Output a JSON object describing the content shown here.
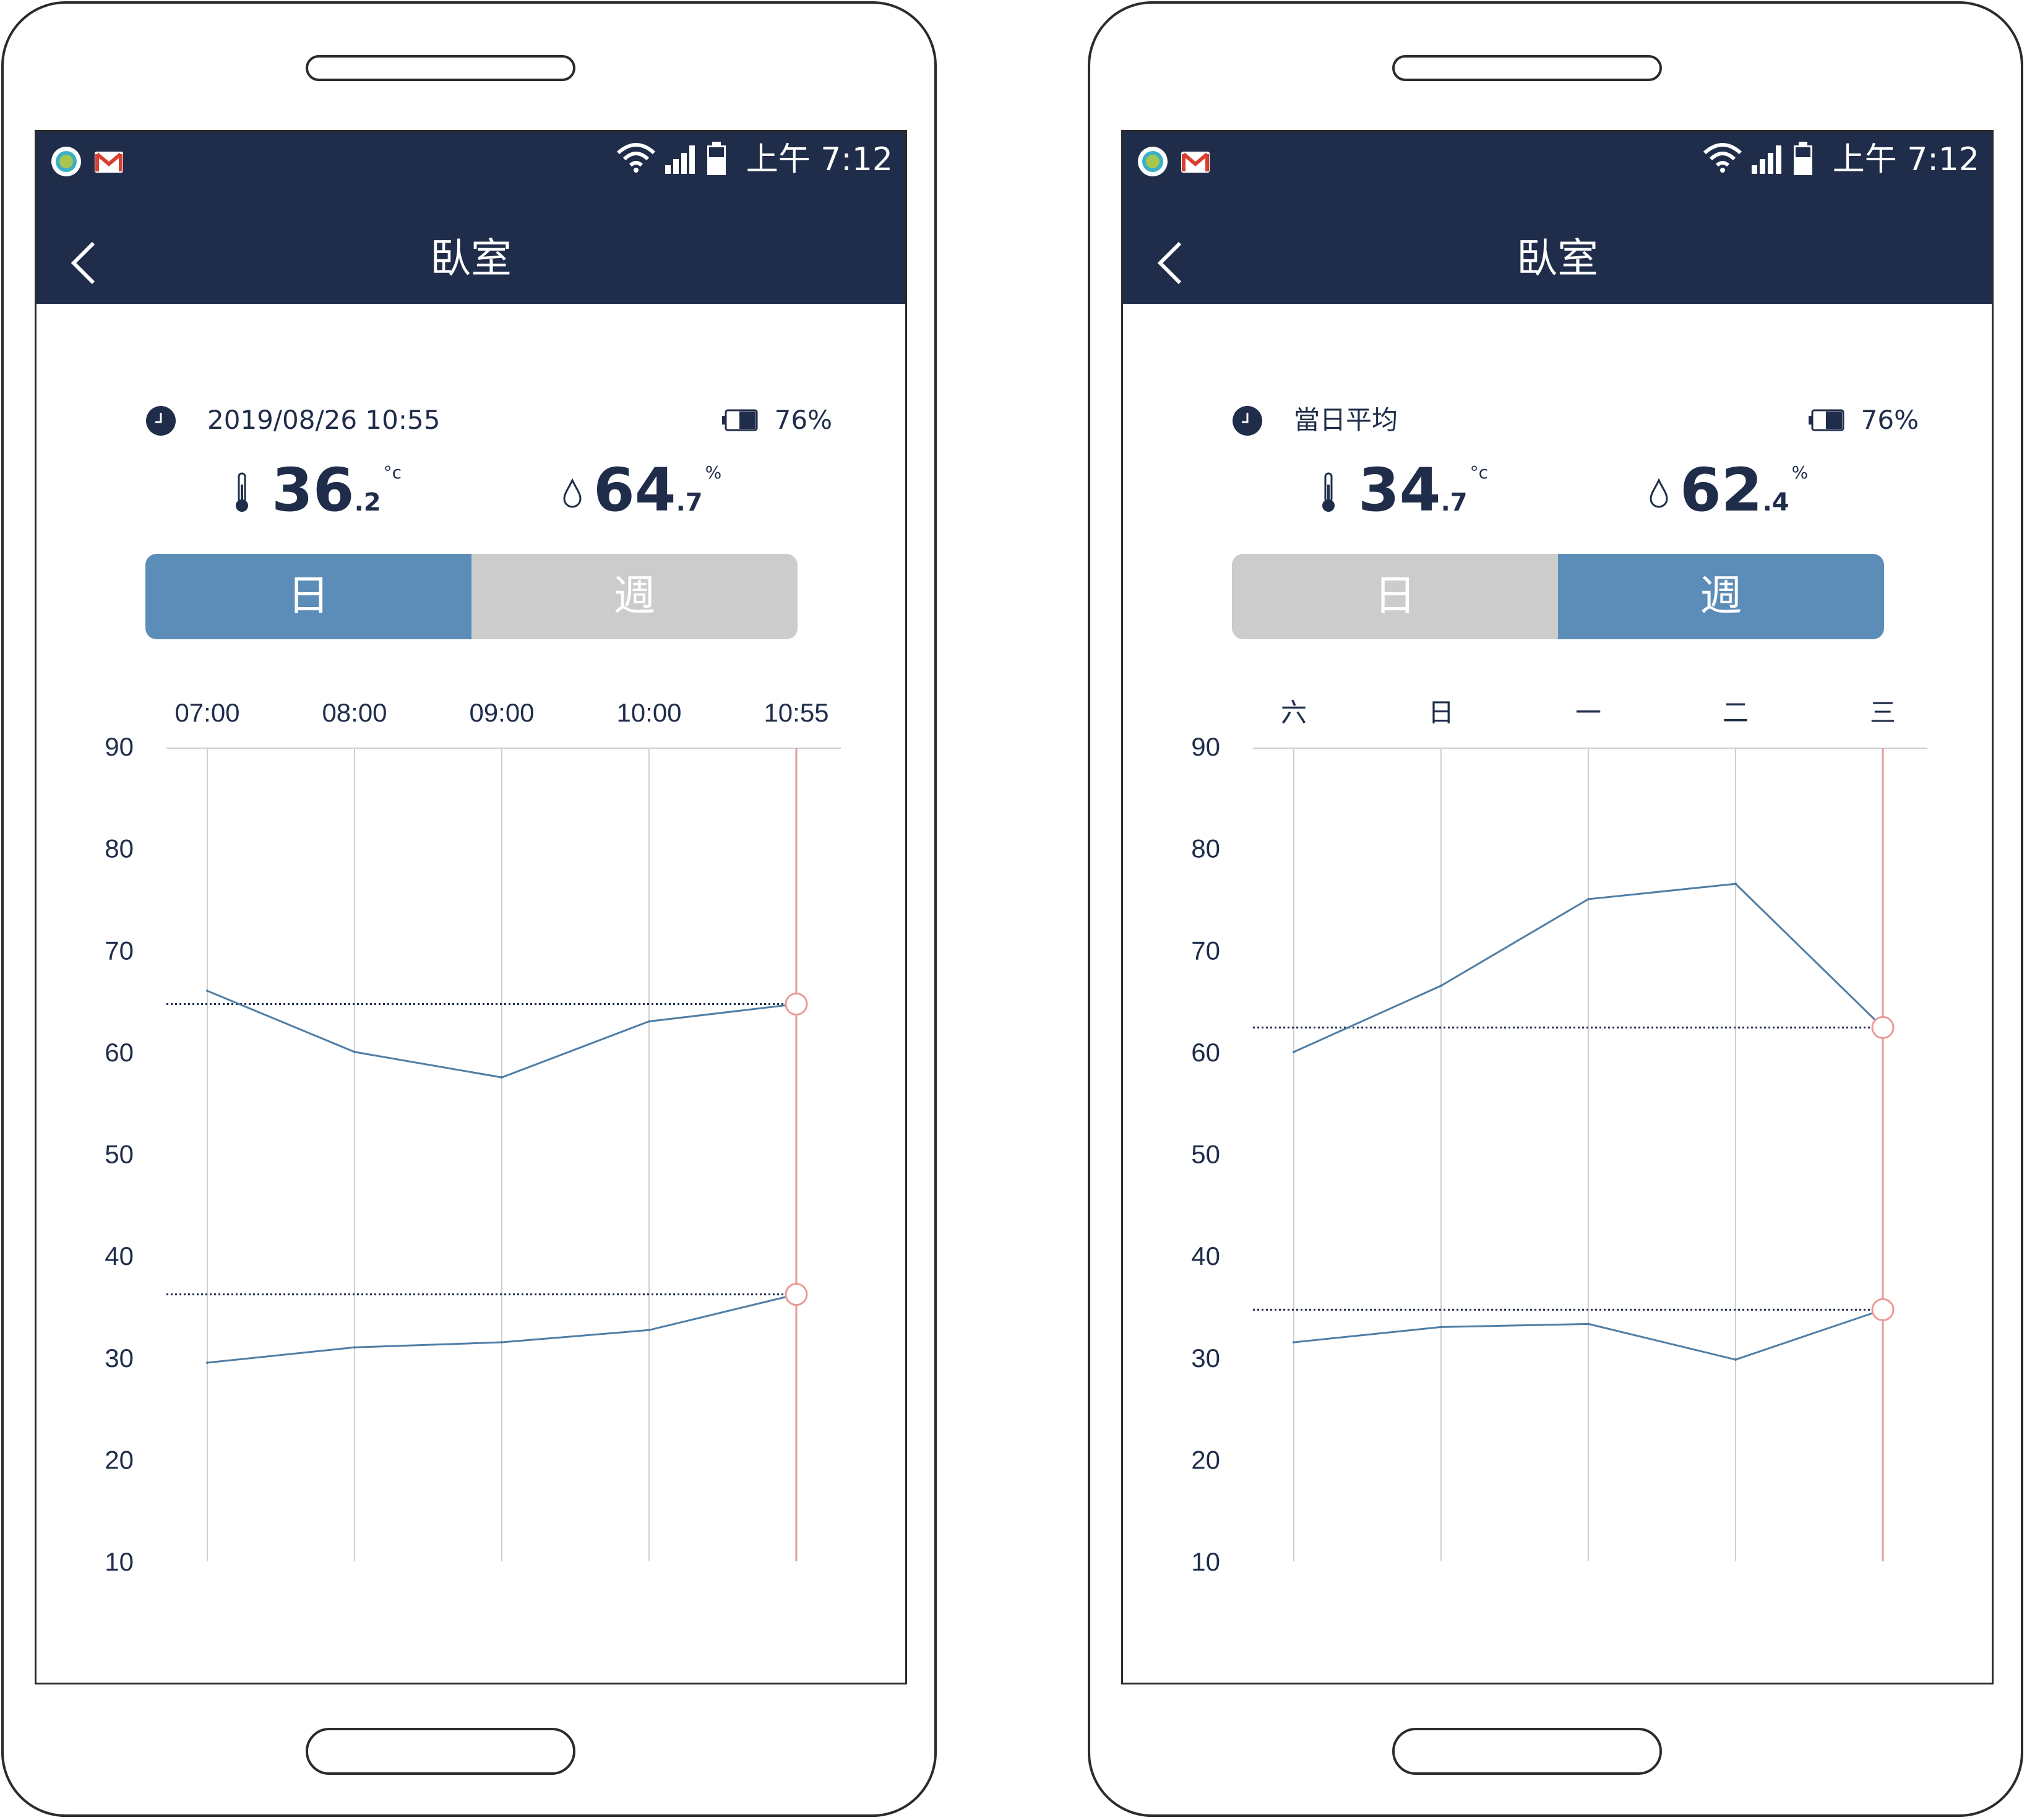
{
  "phones": [
    {
      "status_bar": {
        "time": "上午 7:12",
        "icons": [
          "circle-app-icon",
          "gmail-icon",
          "wifi-icon",
          "signal-icon",
          "battery-icon"
        ]
      },
      "nav": {
        "title": "臥室",
        "back_icon": "chevron-left-icon"
      },
      "info": {
        "label": "2019/08/26 10:55",
        "battery": "76%"
      },
      "temperature": {
        "int": "36",
        "dec": ".2",
        "unit": "°c"
      },
      "humidity": {
        "int": "64",
        "dec": ".7",
        "unit": "%"
      },
      "tabs": [
        {
          "label": "日",
          "active": true
        },
        {
          "label": "週",
          "active": false
        }
      ],
      "colors": {
        "active": "#5b8db8",
        "inactive": "#cccccc",
        "line": "#4f7ea6",
        "marker": "#ea9a98"
      }
    },
    {
      "status_bar": {
        "time": "上午 7:12",
        "icons": [
          "circle-app-icon",
          "gmail-icon",
          "wifi-icon",
          "signal-icon",
          "battery-icon"
        ]
      },
      "nav": {
        "title": "臥室",
        "back_icon": "chevron-left-icon"
      },
      "info": {
        "label": "當日平均",
        "battery": "76%"
      },
      "temperature": {
        "int": "34",
        "dec": ".7",
        "unit": "°c"
      },
      "humidity": {
        "int": "62",
        "dec": ".4",
        "unit": "%"
      },
      "tabs": [
        {
          "label": "日",
          "active": false
        },
        {
          "label": "週",
          "active": true
        }
      ],
      "colors": {
        "active": "#5b8db8",
        "inactive": "#cccccc",
        "line": "#4f7ea6",
        "marker": "#ea9a98"
      }
    }
  ],
  "chart_data": [
    {
      "type": "line",
      "categories": [
        "07:00",
        "08:00",
        "09:00",
        "10:00",
        "10:55"
      ],
      "ylim": [
        10,
        90
      ],
      "yticks": [
        90,
        80,
        70,
        60,
        50,
        40,
        30,
        20,
        10
      ],
      "series": [
        {
          "values": [
            66,
            60,
            57.5,
            63,
            64.7
          ]
        },
        {
          "values": [
            29.5,
            31,
            31.5,
            32.7,
            36.2
          ]
        }
      ],
      "reference_lines": [
        64.7,
        36.2
      ],
      "grid": "vertical"
    },
    {
      "type": "line",
      "categories": [
        "六",
        "日",
        "一",
        "二",
        "三"
      ],
      "ylim": [
        10,
        90
      ],
      "yticks": [
        90,
        80,
        70,
        60,
        50,
        40,
        30,
        20,
        10
      ],
      "series": [
        {
          "values": [
            60,
            66.5,
            75,
            76.5,
            62.4
          ]
        },
        {
          "values": [
            31.5,
            33,
            33.3,
            29.8,
            34.7
          ]
        }
      ],
      "reference_lines": [
        62.4,
        34.7
      ],
      "grid": "vertical"
    }
  ]
}
